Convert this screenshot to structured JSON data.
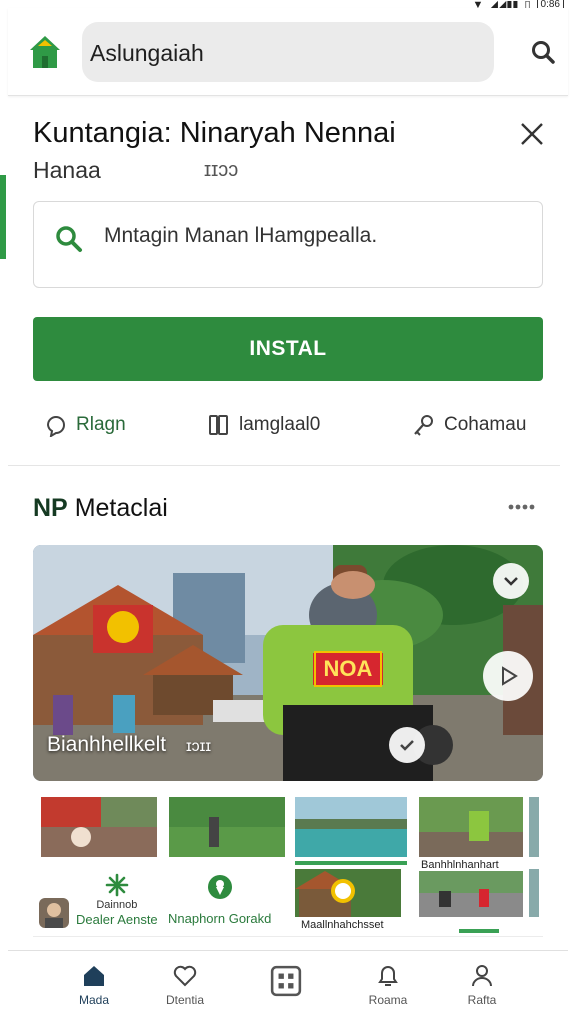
{
  "status_bar": {
    "battery": "0:86"
  },
  "header": {
    "search_text": "Aslungaiah",
    "logo_icon": "home-logo-icon",
    "search_icon": "search-icon"
  },
  "app": {
    "title": "Kuntangia: Ninaryah Nennai",
    "subtitle": "Hanaa",
    "meta": "ɪɪɔɔ"
  },
  "search": {
    "text": "Mntagin Manan lHamgpealla."
  },
  "install_label": "INSTAL",
  "actions": [
    {
      "label": "Rlagn",
      "icon": "share-icon"
    },
    {
      "label": "lamglaal0",
      "icon": "book-icon"
    },
    {
      "label": "Cohamau",
      "icon": "key-icon"
    }
  ],
  "section": {
    "title_bold": "NP",
    "title_rest": "Metaclai"
  },
  "hero": {
    "caption": "Bianhhellkelt",
    "caption_meta": "ɪɔɪɪ",
    "sign_text": "NOA"
  },
  "grid": {
    "items": [
      {
        "label": "Dealer Aenste",
        "label_top": "Dainnob"
      },
      {
        "label": "Nnaphorn Gorakd"
      }
    ],
    "thumb_captions": [
      "Banhhlnhanhart",
      "Maallnhahchsset"
    ]
  },
  "accent_color": "#2e8b3e",
  "nav": [
    {
      "label": "Mada",
      "icon": "home-icon"
    },
    {
      "label": "Dtentia",
      "icon": "heart-icon"
    },
    {
      "label": "",
      "icon": "grid-icon"
    },
    {
      "label": "Roama",
      "icon": "bell-icon"
    },
    {
      "label": "Rafta",
      "icon": "profile-icon"
    }
  ]
}
